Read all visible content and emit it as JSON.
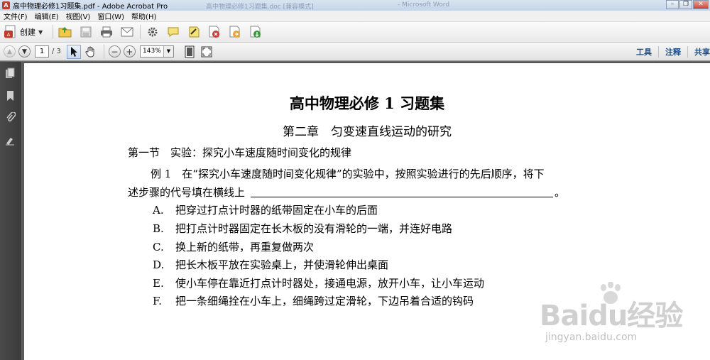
{
  "window": {
    "title": "高中物理必修1习题集.pdf - Adobe Acrobat Pro",
    "background_title_1": "高中物理必修1习题集.doc [兼容模式]",
    "background_title_2": "- Microsoft Word"
  },
  "menu": [
    "文件(F)",
    "编辑(E)",
    "视图(V)",
    "窗口(W)",
    "帮助(H)"
  ],
  "toolbar": {
    "create_label": "创建",
    "icons": [
      "open-folder-icon",
      "save-icon",
      "print-icon",
      "email-icon",
      "settings-icon",
      "comment-icon",
      "sign-icon",
      "pdf-secure-icon",
      "pdf-export-icon",
      "pdf-import-icon"
    ]
  },
  "nav_toolbar": {
    "page_current": "1",
    "page_total": "/ 3",
    "zoom": "143%",
    "right_links": [
      "工具",
      "注释",
      "共享"
    ]
  },
  "document": {
    "title": "高中物理必修 1 习题集",
    "chapter": "第二章　匀变速直线运动的研究",
    "section": "第一节　实验：探究小车速度随时间变化的规律",
    "example_line1": "例 1　在“探究小车速度随时间变化规律”的实验中，按照实验进行的先后顺序，将下",
    "example_line2": "述步骤的代号填在横线上",
    "example_line2_end": "。",
    "options": [
      {
        "letter": "A.",
        "text": "把穿过打点计时器的纸带固定在小车的后面"
      },
      {
        "letter": "B.",
        "text": "把打点计时器固定在长木板的没有滑轮的一端，并连好电路"
      },
      {
        "letter": "C.",
        "text": "换上新的纸带，再重复做两次"
      },
      {
        "letter": "D.",
        "text": "把长木板平放在实验桌上，并使滑轮伸出桌面"
      },
      {
        "letter": "E.",
        "text": "使小车停在靠近打点计时器处，接通电源，放开小车，让小车运动"
      },
      {
        "letter": "F.",
        "text": "把一条细绳拴在小车上，细绳跨过定滑轮，下边吊着合适的钩码"
      }
    ]
  },
  "watermark": {
    "brand": "Baidu经验",
    "url": "jingyan.baidu.com"
  },
  "colors": {
    "link_blue": "#1c4f8a",
    "nav_pane": "#3c3c3c"
  }
}
